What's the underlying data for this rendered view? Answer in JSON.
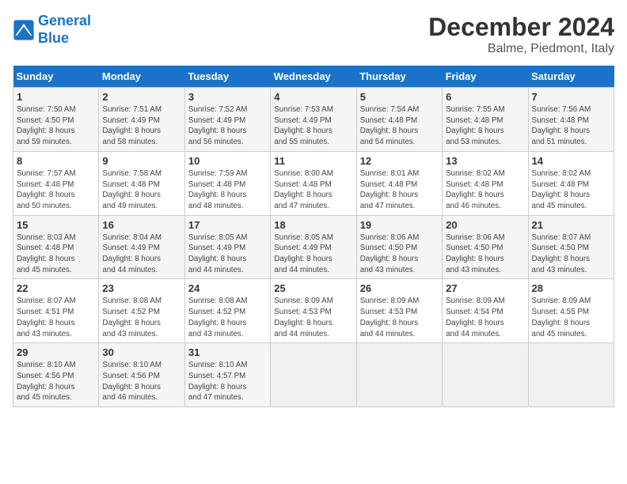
{
  "header": {
    "logo_line1": "General",
    "logo_line2": "Blue",
    "title": "December 2024",
    "subtitle": "Balme, Piedmont, Italy"
  },
  "weekdays": [
    "Sunday",
    "Monday",
    "Tuesday",
    "Wednesday",
    "Thursday",
    "Friday",
    "Saturday"
  ],
  "weeks": [
    [
      {
        "day": "1",
        "detail": "Sunrise: 7:50 AM\nSunset: 4:50 PM\nDaylight: 8 hours\nand 59 minutes."
      },
      {
        "day": "2",
        "detail": "Sunrise: 7:51 AM\nSunset: 4:49 PM\nDaylight: 8 hours\nand 58 minutes."
      },
      {
        "day": "3",
        "detail": "Sunrise: 7:52 AM\nSunset: 4:49 PM\nDaylight: 8 hours\nand 56 minutes."
      },
      {
        "day": "4",
        "detail": "Sunrise: 7:53 AM\nSunset: 4:49 PM\nDaylight: 8 hours\nand 55 minutes."
      },
      {
        "day": "5",
        "detail": "Sunrise: 7:54 AM\nSunset: 4:48 PM\nDaylight: 8 hours\nand 54 minutes."
      },
      {
        "day": "6",
        "detail": "Sunrise: 7:55 AM\nSunset: 4:48 PM\nDaylight: 8 hours\nand 53 minutes."
      },
      {
        "day": "7",
        "detail": "Sunrise: 7:56 AM\nSunset: 4:48 PM\nDaylight: 8 hours\nand 51 minutes."
      }
    ],
    [
      {
        "day": "8",
        "detail": "Sunrise: 7:57 AM\nSunset: 4:48 PM\nDaylight: 8 hours\nand 50 minutes."
      },
      {
        "day": "9",
        "detail": "Sunrise: 7:58 AM\nSunset: 4:48 PM\nDaylight: 8 hours\nand 49 minutes."
      },
      {
        "day": "10",
        "detail": "Sunrise: 7:59 AM\nSunset: 4:48 PM\nDaylight: 8 hours\nand 48 minutes."
      },
      {
        "day": "11",
        "detail": "Sunrise: 8:00 AM\nSunset: 4:48 PM\nDaylight: 8 hours\nand 47 minutes."
      },
      {
        "day": "12",
        "detail": "Sunrise: 8:01 AM\nSunset: 4:48 PM\nDaylight: 8 hours\nand 47 minutes."
      },
      {
        "day": "13",
        "detail": "Sunrise: 8:02 AM\nSunset: 4:48 PM\nDaylight: 8 hours\nand 46 minutes."
      },
      {
        "day": "14",
        "detail": "Sunrise: 8:02 AM\nSunset: 4:48 PM\nDaylight: 8 hours\nand 45 minutes."
      }
    ],
    [
      {
        "day": "15",
        "detail": "Sunrise: 8:03 AM\nSunset: 4:48 PM\nDaylight: 8 hours\nand 45 minutes."
      },
      {
        "day": "16",
        "detail": "Sunrise: 8:04 AM\nSunset: 4:49 PM\nDaylight: 8 hours\nand 44 minutes."
      },
      {
        "day": "17",
        "detail": "Sunrise: 8:05 AM\nSunset: 4:49 PM\nDaylight: 8 hours\nand 44 minutes."
      },
      {
        "day": "18",
        "detail": "Sunrise: 8:05 AM\nSunset: 4:49 PM\nDaylight: 8 hours\nand 44 minutes."
      },
      {
        "day": "19",
        "detail": "Sunrise: 8:06 AM\nSunset: 4:50 PM\nDaylight: 8 hours\nand 43 minutes."
      },
      {
        "day": "20",
        "detail": "Sunrise: 8:06 AM\nSunset: 4:50 PM\nDaylight: 8 hours\nand 43 minutes."
      },
      {
        "day": "21",
        "detail": "Sunrise: 8:07 AM\nSunset: 4:50 PM\nDaylight: 8 hours\nand 43 minutes."
      }
    ],
    [
      {
        "day": "22",
        "detail": "Sunrise: 8:07 AM\nSunset: 4:51 PM\nDaylight: 8 hours\nand 43 minutes."
      },
      {
        "day": "23",
        "detail": "Sunrise: 8:08 AM\nSunset: 4:52 PM\nDaylight: 8 hours\nand 43 minutes."
      },
      {
        "day": "24",
        "detail": "Sunrise: 8:08 AM\nSunset: 4:52 PM\nDaylight: 8 hours\nand 43 minutes."
      },
      {
        "day": "25",
        "detail": "Sunrise: 8:09 AM\nSunset: 4:53 PM\nDaylight: 8 hours\nand 44 minutes."
      },
      {
        "day": "26",
        "detail": "Sunrise: 8:09 AM\nSunset: 4:53 PM\nDaylight: 8 hours\nand 44 minutes."
      },
      {
        "day": "27",
        "detail": "Sunrise: 8:09 AM\nSunset: 4:54 PM\nDaylight: 8 hours\nand 44 minutes."
      },
      {
        "day": "28",
        "detail": "Sunrise: 8:09 AM\nSunset: 4:55 PM\nDaylight: 8 hours\nand 45 minutes."
      }
    ],
    [
      {
        "day": "29",
        "detail": "Sunrise: 8:10 AM\nSunset: 4:56 PM\nDaylight: 8 hours\nand 45 minutes."
      },
      {
        "day": "30",
        "detail": "Sunrise: 8:10 AM\nSunset: 4:56 PM\nDaylight: 8 hours\nand 46 minutes."
      },
      {
        "day": "31",
        "detail": "Sunrise: 8:10 AM\nSunset: 4:57 PM\nDaylight: 8 hours\nand 47 minutes."
      },
      null,
      null,
      null,
      null
    ]
  ]
}
